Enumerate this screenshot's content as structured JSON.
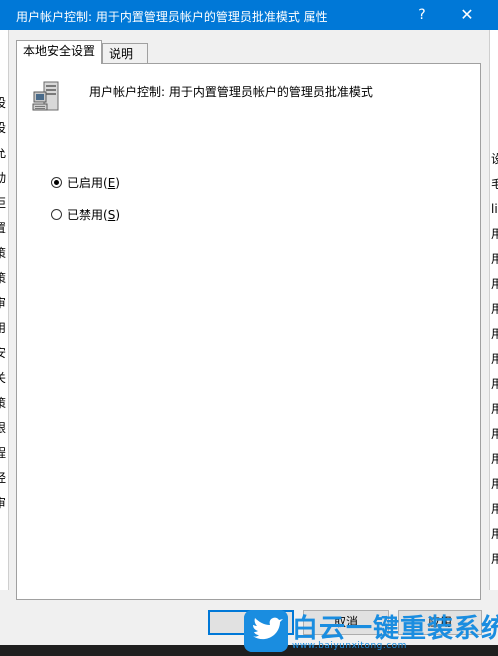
{
  "window": {
    "title": "用户帐户控制: 用于内置管理员帐户的管理员批准模式 属性",
    "help_label": "?",
    "close_label": "✕"
  },
  "tabs": [
    {
      "label": "本地安全设置",
      "active": true
    },
    {
      "label": "说明",
      "active": false
    }
  ],
  "policy": {
    "icon": "server-computer-icon",
    "name": "用户帐户控制: 用于内置管理员帐户的管理员批准模式"
  },
  "options": [
    {
      "label": "已启用(",
      "mnemonic": "E",
      "suffix": ")",
      "checked": true
    },
    {
      "label": "已禁用(",
      "mnemonic": "S",
      "suffix": ")",
      "checked": false
    }
  ],
  "buttons": {
    "ok": "确",
    "cancel": "取消",
    "apply": "应用"
  },
  "background_left": [
    "设",
    "设",
    "允",
    "动",
    "拒",
    "置",
    "策",
    "策",
    "审",
    "用",
    "安",
    "关",
    "策",
    "限",
    "程",
    "经",
    "审"
  ],
  "background_right": [
    "设",
    "毛",
    "lir",
    "用",
    "用",
    "用",
    "用",
    "用",
    "用",
    "用",
    "用",
    "用",
    "用",
    "用",
    "用",
    "用",
    "用"
  ],
  "watermark": {
    "text": "白云一键重装系统",
    "url": "www.baiyunxitong.com",
    "accent": "#1a8de0"
  }
}
